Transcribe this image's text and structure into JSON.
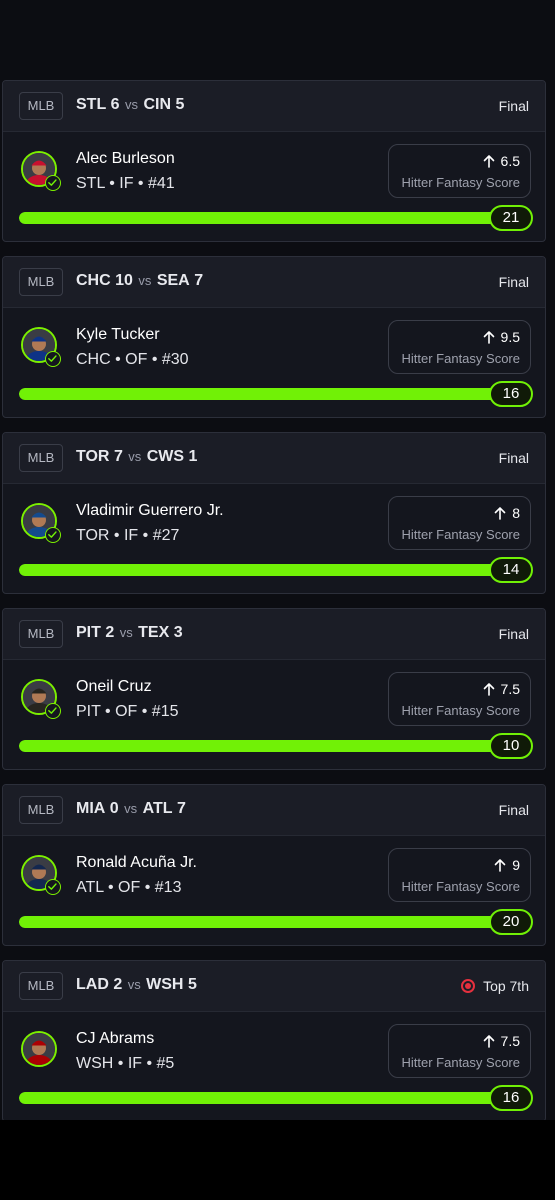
{
  "proj_label": "Hitter Fantasy Score",
  "colors": {
    "accent": "#71f106",
    "live": "#e5303e",
    "card": "#14161e",
    "header": "#1b1d26"
  },
  "cards": [
    {
      "league": "MLB",
      "away_team": "STL",
      "away_score": "6",
      "vs": "vs",
      "home_team": "CIN",
      "home_score": "5",
      "status": "Final",
      "live": false,
      "player": "Alec Burleson",
      "meta": "STL • IF • #41",
      "projection": "6.5",
      "score": "21",
      "progress": 1.0,
      "jersey": "#c8102e"
    },
    {
      "league": "MLB",
      "away_team": "CHC",
      "away_score": "10",
      "vs": "vs",
      "home_team": "SEA",
      "home_score": "7",
      "status": "Final",
      "live": false,
      "player": "Kyle Tucker",
      "meta": "CHC • OF • #30",
      "projection": "9.5",
      "score": "16",
      "progress": 1.0,
      "jersey": "#0e3386"
    },
    {
      "league": "MLB",
      "away_team": "TOR",
      "away_score": "7",
      "vs": "vs",
      "home_team": "CWS",
      "home_score": "1",
      "status": "Final",
      "live": false,
      "player": "Vladimir Guerrero Jr.",
      "meta": "TOR • IF • #27",
      "projection": "8",
      "score": "14",
      "progress": 1.0,
      "jersey": "#134a8e"
    },
    {
      "league": "MLB",
      "away_team": "PIT",
      "away_score": "2",
      "vs": "vs",
      "home_team": "TEX",
      "home_score": "3",
      "status": "Final",
      "live": false,
      "player": "Oneil Cruz",
      "meta": "PIT • OF • #15",
      "projection": "7.5",
      "score": "10",
      "progress": 1.0,
      "jersey": "#27251f"
    },
    {
      "league": "MLB",
      "away_team": "MIA",
      "away_score": "0",
      "vs": "vs",
      "home_team": "ATL",
      "home_score": "7",
      "status": "Final",
      "live": false,
      "player": "Ronald Acuña Jr.",
      "meta": "ATL • OF • #13",
      "projection": "9",
      "score": "20",
      "progress": 1.0,
      "jersey": "#13274f"
    },
    {
      "league": "MLB",
      "away_team": "LAD",
      "away_score": "2",
      "vs": "vs",
      "home_team": "WSH",
      "home_score": "5",
      "status": "Top 7th",
      "live": true,
      "player": "CJ Abrams",
      "meta": "WSH • IF • #5",
      "projection": "7.5",
      "score": "16",
      "progress": 1.0,
      "jersey": "#ab0003"
    }
  ]
}
